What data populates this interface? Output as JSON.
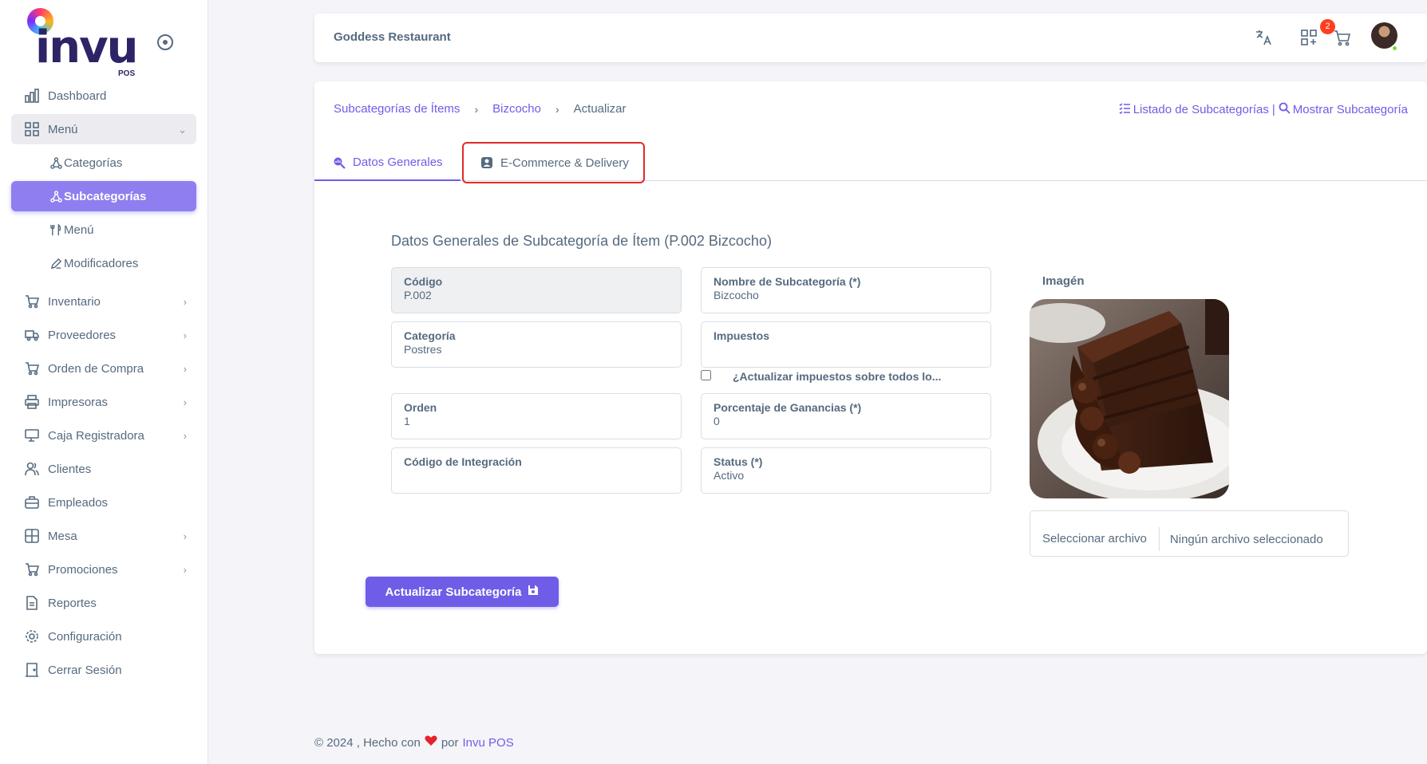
{
  "brand": {
    "logo_text": "invu",
    "logo_sub": "POS"
  },
  "sidebar": {
    "items": [
      {
        "label": "Dashboard",
        "icon": "bar-chart-icon"
      },
      {
        "label": "Menú",
        "icon": "grid-icon",
        "open": true
      },
      {
        "label": "Inventario",
        "icon": "cart-icon"
      },
      {
        "label": "Proveedores",
        "icon": "truck-icon"
      },
      {
        "label": "Orden de Compra",
        "icon": "cart-icon"
      },
      {
        "label": "Impresoras",
        "icon": "printer-icon"
      },
      {
        "label": "Caja Registradora",
        "icon": "register-icon"
      },
      {
        "label": "Clientes",
        "icon": "users-icon"
      },
      {
        "label": "Empleados",
        "icon": "briefcase-icon"
      },
      {
        "label": "Mesa",
        "icon": "table-icon"
      },
      {
        "label": "Promociones",
        "icon": "cart-icon"
      },
      {
        "label": "Reportes",
        "icon": "document-icon"
      },
      {
        "label": "Configuración",
        "icon": "gear-icon"
      },
      {
        "label": "Cerrar Sesión",
        "icon": "door-icon"
      }
    ],
    "submenu": [
      {
        "label": "Categorías",
        "icon": "share-icon"
      },
      {
        "label": "Subcategorías",
        "icon": "share-icon",
        "active": true
      },
      {
        "label": "Menú",
        "icon": "utensils-icon"
      },
      {
        "label": "Modificadores",
        "icon": "edit-icon"
      }
    ]
  },
  "topbar": {
    "restaurant": "Goddess Restaurant",
    "cart_count": "2"
  },
  "breadcrumb": {
    "level1": "Subcategorías de Ítems",
    "level2": "Bizcocho",
    "current": "Actualizar"
  },
  "actions": {
    "list_link": "Listado de Subcategorías",
    "separator": "|",
    "show_link": "Mostrar Subcategoría"
  },
  "tabs": {
    "general": "Datos Generales",
    "ecommerce": "E-Commerce & Delivery"
  },
  "form": {
    "title": "Datos Generales de Subcategoría de Ítem (P.002 Bizcocho)",
    "codigo_label": "Código",
    "codigo_value": "P.002",
    "nombre_label": "Nombre de Subcategoría (*)",
    "nombre_value": "Bizcocho",
    "categoria_label": "Categoría",
    "categoria_value": "Postres",
    "impuestos_label": "Impuestos",
    "impuestos_value": "",
    "checkbox_label": "¿Actualizar impuestos sobre todos lo...",
    "orden_label": "Orden",
    "orden_value": "1",
    "ganancias_label": "Porcentaje de Ganancias (*)",
    "ganancias_value": "0",
    "integracion_label": "Código de Integración",
    "integracion_value": "",
    "status_label": "Status (*)",
    "status_value": "Activo",
    "image_label": "Imagén",
    "file_button": "Seleccionar archivo",
    "file_none": "Ningún archivo seleccionado",
    "submit": "Actualizar Subcategoría"
  },
  "footer": {
    "prefix": "© 2024 , Hecho con",
    "by": "por",
    "link": "Invu POS"
  },
  "colors": {
    "accent": "#6f5de8",
    "active_sub": "#8f7ef0",
    "badge": "#ff3e1d",
    "highlight_border": "#e12a2a"
  }
}
